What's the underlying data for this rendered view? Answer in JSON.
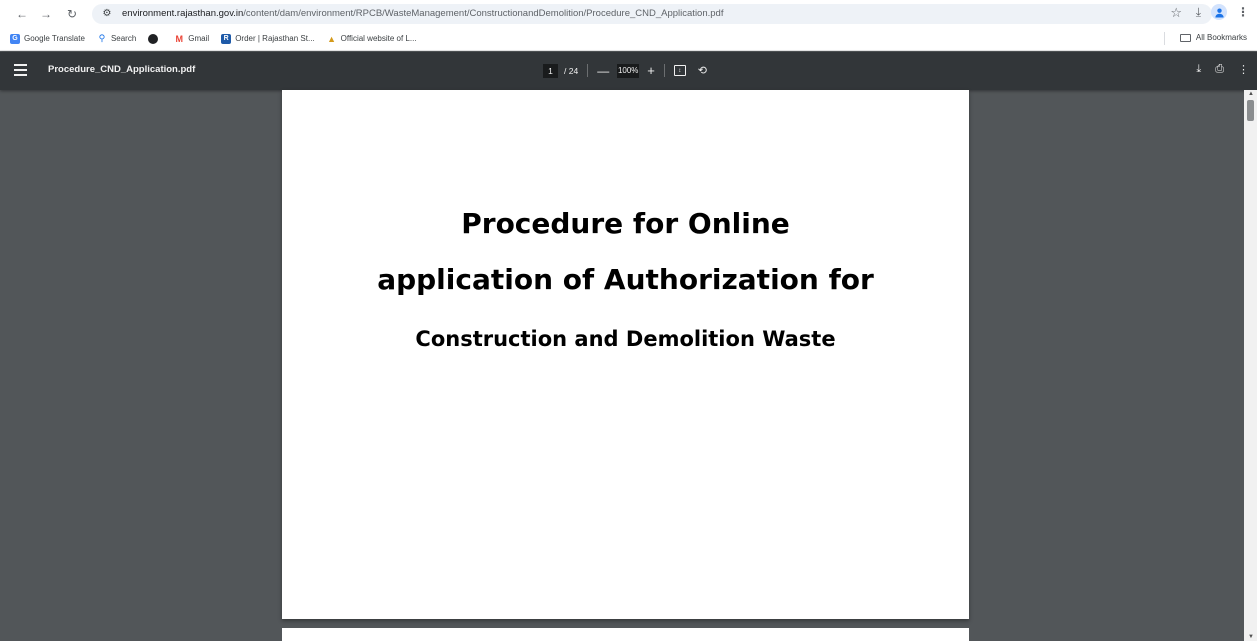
{
  "browser": {
    "url_host": "environment.rajasthan.gov.in",
    "url_path": "/content/dam/environment/RPCB/WasteManagement/ConstructionandDemolition/Procedure_CND_Application.pdf"
  },
  "bookmarks": {
    "items": [
      {
        "label": "Google Translate",
        "icon": "google-translate-icon"
      },
      {
        "label": "Search",
        "icon": "search-icon"
      },
      {
        "label": "",
        "icon": "chrome-icon"
      },
      {
        "label": "Gmail",
        "icon": "gmail-icon"
      },
      {
        "label": "Order | Rajasthan St...",
        "icon": "order-icon"
      },
      {
        "label": "Official website of L...",
        "icon": "official-website-icon"
      }
    ],
    "all_bookmarks": "All Bookmarks"
  },
  "pdf_viewer": {
    "file_name": "Procedure_CND_Application.pdf",
    "current_page": "1",
    "page_total": "/ 24",
    "zoom": "100%"
  },
  "document": {
    "line1": "Procedure for Online",
    "line2": "application of  Authorization for",
    "line3": "Construction and Demolition Waste"
  },
  "colors": {
    "toolbar_bg": "#323639",
    "viewer_bg": "#525659",
    "page_bg": "#ffffff"
  }
}
